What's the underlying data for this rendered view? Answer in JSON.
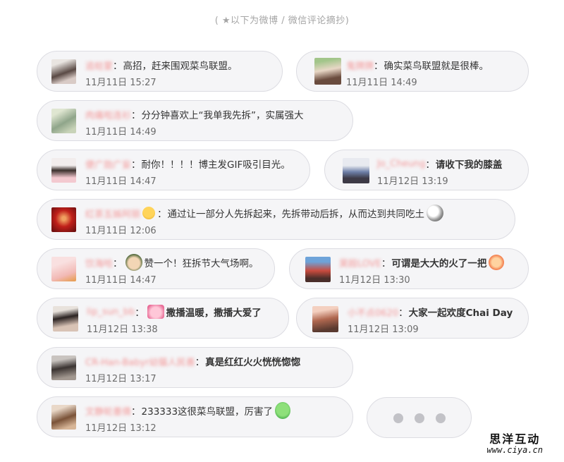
{
  "header": "( ★以下为微博 / 微信评论摘抄)",
  "comments": [
    {
      "name": "追蛀蒙",
      "text": "高招，赶来围观菜鸟联盟。",
      "time": "11月11日 15:27",
      "bold": false
    },
    {
      "name": "鬼牌牌",
      "text": "确实菜鸟联盟就是很棒。",
      "time": "11月11日 14:49",
      "bold": false
    },
    {
      "name": "肉痛啦连衫",
      "text": "分分钟喜欢上“我单我先拆”，实属强大",
      "time": "11月11日 14:49",
      "bold": false
    },
    {
      "name": "便广勋广妄",
      "text": "耐你！！！！博主发GIF吸引目光。",
      "time": "11月11日 14:47",
      "bold": false
    },
    {
      "name": "Jo_Cheung",
      "text": "请收下我的膝盖",
      "time": "11月12日 13:19",
      "bold": true
    },
    {
      "name": "红茶五姊阿丽",
      "text": "通过让一部分人先拆起来，先拆带动后拆，从而达到共同吃土",
      "time": "11月11日 12:06",
      "bold": false
    },
    {
      "name": "饮海哈",
      "text": "赞一个！狂拆节大气场啊。",
      "time": "11月11日 14:47",
      "bold": false
    },
    {
      "name": "昊殴LOVE",
      "text": "可谓是大大的火了一把",
      "time": "11月12日 13:30",
      "bold": true
    },
    {
      "name": "lip_sun_bb",
      "text": "撒播温暖，撒播大爱了",
      "time": "11月12日 13:38",
      "bold": true
    },
    {
      "name": "小不点0620",
      "text": "大家一起欢度Chai Day",
      "time": "11月12日 13:09",
      "bold": true
    },
    {
      "name": "CR-Han-Babyr幼猫人民善",
      "text": "真是红红火火恍恍惚惚",
      "time": "11月12日 13:17",
      "bold": true
    },
    {
      "name": "文静轮墨倩",
      "text": "233333这很菜鸟联盟，厉害了",
      "time": "11月12日 13:12",
      "bold": false
    }
  ],
  "watermark": {
    "cn": "思洋互动",
    "url": "www.ciya.cn"
  },
  "colors": {
    "bubble": "#f5f5f7",
    "border": "#dcdce2",
    "name": "#f38b8b",
    "dots": "#c2c2c7"
  }
}
